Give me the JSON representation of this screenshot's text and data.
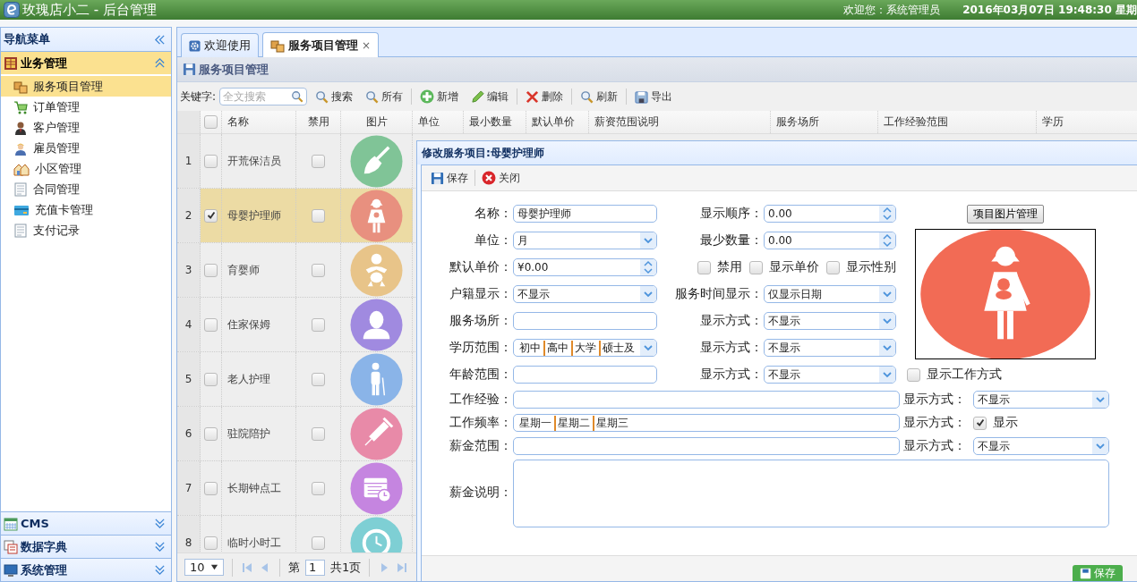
{
  "header": {
    "title": "玫瑰店小二 - 后台管理",
    "welcome": "欢迎您：系统管理员",
    "datetime": "2016年03月07日 19:48:30 星期"
  },
  "sidebar": {
    "title": "导航菜单",
    "sections": [
      {
        "label": "业务管理",
        "expanded": true,
        "items": [
          {
            "label": "服务项目管理",
            "selected": true
          },
          {
            "label": "订单管理",
            "selected": false
          },
          {
            "label": "客户管理",
            "selected": false
          },
          {
            "label": "雇员管理",
            "selected": false
          },
          {
            "label": "小区管理",
            "selected": false
          },
          {
            "label": "合同管理",
            "selected": false
          },
          {
            "label": "充值卡管理",
            "selected": false
          },
          {
            "label": "支付记录",
            "selected": false
          }
        ]
      },
      {
        "label": "CMS",
        "expanded": false
      },
      {
        "label": "数据字典",
        "expanded": false
      },
      {
        "label": "系统管理",
        "expanded": false
      }
    ]
  },
  "tabs": [
    {
      "label": "欢迎使用",
      "selected": false
    },
    {
      "label": "服务项目管理",
      "selected": true,
      "close": "×"
    }
  ],
  "panel_title": "服务项目管理",
  "toolbar": {
    "keyword_label": "关键字:",
    "search_placeholder": "全文搜索",
    "buttons": [
      {
        "kind": "search",
        "label": "搜索"
      },
      {
        "kind": "all",
        "label": "所有"
      },
      {
        "kind": "add",
        "label": "新增"
      },
      {
        "kind": "edit",
        "label": "编辑"
      },
      {
        "kind": "delete",
        "label": "删除"
      },
      {
        "kind": "refresh",
        "label": "刷新"
      },
      {
        "kind": "export",
        "label": "导出"
      }
    ]
  },
  "grid": {
    "header_checked": false,
    "columns": [
      "名称",
      "禁用",
      "图片",
      "单位",
      "最小数量",
      "默认单价",
      "薪资范围说明",
      "服务场所",
      "工作经验范围",
      "学历"
    ],
    "rows": [
      {
        "number": "1",
        "name": "开荒保洁员",
        "selected": false,
        "disabled": false,
        "color": "#80c497"
      },
      {
        "number": "2",
        "name": "母婴护理师",
        "selected": true,
        "disabled": false,
        "color": "#e8907f"
      },
      {
        "number": "3",
        "name": "育婴师",
        "selected": false,
        "disabled": false,
        "color": "#e8c489"
      },
      {
        "number": "4",
        "name": "住家保姆",
        "selected": false,
        "disabled": false,
        "color": "#a08ae0"
      },
      {
        "number": "5",
        "name": "老人护理",
        "selected": false,
        "disabled": false,
        "color": "#8ab4e8"
      },
      {
        "number": "6",
        "name": "驻院陪护",
        "selected": false,
        "disabled": false,
        "color": "#e88aa8"
      },
      {
        "number": "7",
        "name": "长期钟点工",
        "selected": false,
        "disabled": false,
        "color": "#c585e0"
      },
      {
        "number": "8",
        "name": "临时小时工",
        "selected": false,
        "disabled": false,
        "color": "#7ecfd4"
      }
    ]
  },
  "pager": {
    "page_size": "10",
    "page_label": "第",
    "page": "1",
    "total": "共1页"
  },
  "dialog": {
    "title": "修改服务项目:母婴护理师",
    "toolbar": [
      {
        "kind": "save",
        "label": "保存"
      },
      {
        "kind": "close",
        "label": "关闭"
      }
    ],
    "top_rows": [
      {
        "left": {
          "label": "名称：",
          "kind": "text",
          "value": "母婴护理师"
        },
        "right": {
          "label": "显示顺序：",
          "kind": "spinner",
          "value": "0.00"
        }
      },
      {
        "left": {
          "label": "单位：",
          "kind": "select",
          "value": "月"
        },
        "right": {
          "label": "最少数量：",
          "kind": "spinner",
          "value": "0.00"
        }
      },
      {
        "left": {
          "label": "默认单价：",
          "kind": "spinner",
          "value": "¥0.00"
        },
        "right": {
          "kind": "checks",
          "checks": [
            {
              "label": "禁用",
              "checked": false
            },
            {
              "label": "显示单价",
              "checked": false
            },
            {
              "label": "显示性别",
              "checked": false
            }
          ]
        }
      },
      {
        "left": {
          "label": "户籍显示：",
          "kind": "select",
          "value": "不显示"
        },
        "right": {
          "label": "服务时间显示：",
          "kind": "select",
          "value": "仅显示日期"
        }
      },
      {
        "left": {
          "label": "服务场所：",
          "kind": "text"
        },
        "right": {
          "label": "显示方式：",
          "kind": "select",
          "value": "不显示"
        }
      },
      {
        "left": {
          "label": "学历范围：",
          "kind": "tagselect",
          "tags": [
            "初中",
            "高中",
            "大学",
            "硕士及"
          ]
        },
        "right": {
          "label": "显示方式：",
          "kind": "select",
          "value": "不显示"
        }
      },
      {
        "left": {
          "label": "年龄范围：",
          "kind": "text"
        },
        "right": {
          "label": "显示方式：",
          "kind": "select",
          "value": "不显示"
        }
      }
    ],
    "image_button": "项目图片管理",
    "work_mode": {
      "label": "显示工作方式",
      "checked": false
    },
    "bottom_rows": [
      {
        "label": "工作经验：",
        "field": {
          "kind": "text"
        },
        "mode": {
          "label": "显示方式：",
          "kind": "select",
          "value": "不显示"
        }
      },
      {
        "label": "工作频率：",
        "field": {
          "kind": "tags",
          "tags": [
            "星期一",
            "星期二",
            "星期三"
          ]
        },
        "mode": {
          "label": "显示方式：",
          "kind": "check",
          "checked": true,
          "text": "显示"
        }
      },
      {
        "label": "薪金范围：",
        "field": {
          "kind": "text"
        },
        "mode": {
          "label": "显示方式：",
          "kind": "select",
          "value": "不显示"
        }
      }
    ],
    "note_label": "薪金说明：",
    "footer_button": "保存"
  }
}
